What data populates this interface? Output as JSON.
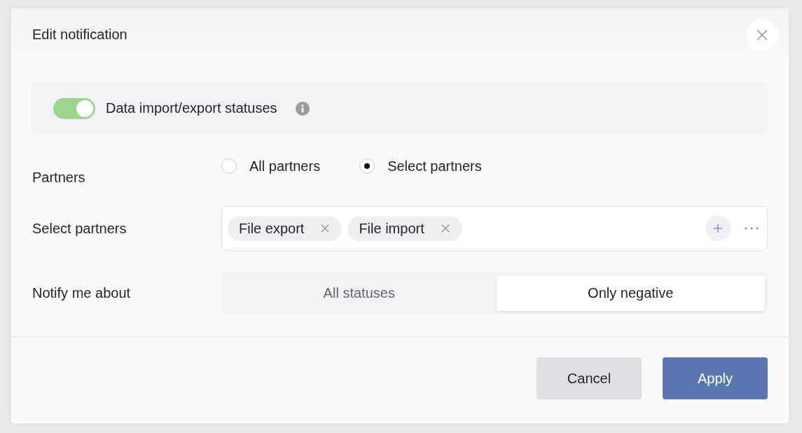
{
  "dialog": {
    "title": "Edit notification"
  },
  "notification": {
    "label": "Data import/export statuses",
    "on": true
  },
  "partners": {
    "label": "Partners",
    "options": [
      {
        "label": "All partners",
        "selected": false
      },
      {
        "label": "Select partners",
        "selected": true
      }
    ]
  },
  "select_partners": {
    "label": "Select partners",
    "tags": [
      "File export",
      "File import"
    ]
  },
  "notify_me_about": {
    "label": "Notify me about",
    "options": [
      {
        "label": "All statuses",
        "selected": false
      },
      {
        "label": "Only negative",
        "selected": true
      }
    ]
  },
  "buttons": [
    {
      "label": "Cancel",
      "kind": "secondary"
    },
    {
      "label": "Apply",
      "kind": "primary"
    }
  ]
}
